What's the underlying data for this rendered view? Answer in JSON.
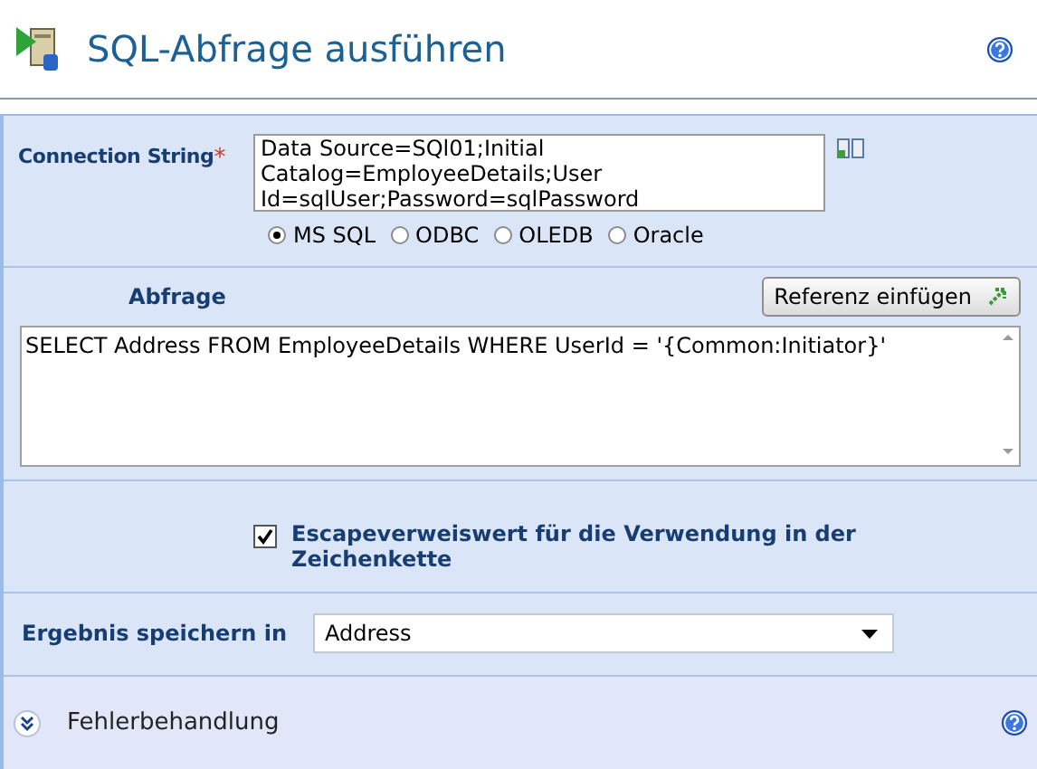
{
  "title": "SQL-Abfrage ausführen",
  "connection": {
    "label": "Connection String",
    "required_mark": "*",
    "value": "Data Source=SQl01;Initial Catalog=EmployeeDetails;User Id=sqlUser;Password=sqlPassword"
  },
  "providers": [
    {
      "label": "MS SQL",
      "selected": true
    },
    {
      "label": "ODBC",
      "selected": false
    },
    {
      "label": "OLEDB",
      "selected": false
    },
    {
      "label": "Oracle",
      "selected": false
    }
  ],
  "query": {
    "label": "Abfrage",
    "button": "Referenz einfügen",
    "value": "SELECT Address FROM EmployeeDetails WHERE UserId = '{Common:Initiator}'"
  },
  "escape": {
    "label": "Escapeverweiswert für die Verwendung in der Zeichenkette",
    "checked": true
  },
  "result": {
    "label": "Ergebnis speichern in",
    "value": "Address"
  },
  "error_section": {
    "label": "Fehlerbehandlung",
    "expanded": false
  }
}
